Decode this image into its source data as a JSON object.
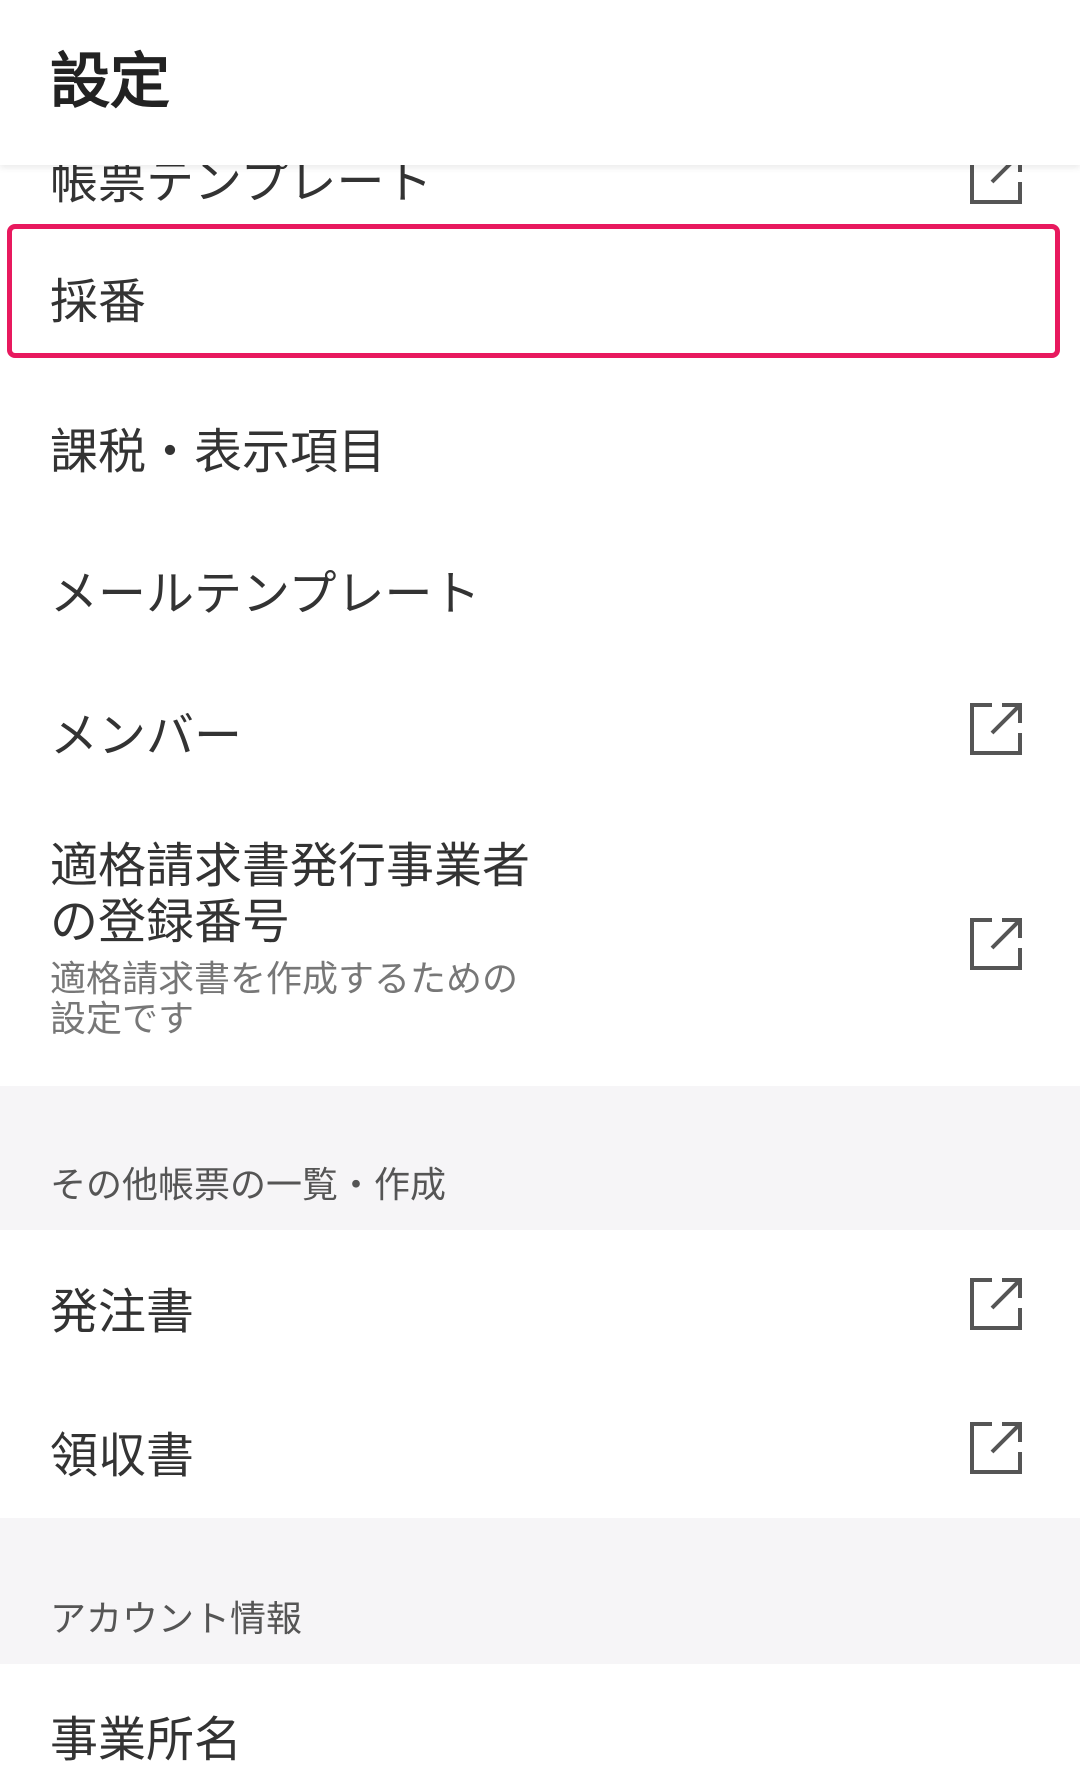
{
  "header": {
    "title": "設定"
  },
  "items": {
    "partial_top": {
      "label": "帳票テンプレート"
    },
    "numbering": {
      "label": "採番"
    },
    "tax_display": {
      "label": "課税・表示項目"
    },
    "mail_template": {
      "label": "メールテンプレート"
    },
    "members": {
      "label": "メンバー"
    },
    "invoice_registration": {
      "label_line1": "適格請求書発行事業者",
      "label_line2": "の登録番号",
      "sub_line1": "適格請求書を作成するための",
      "sub_line2": "設定です"
    },
    "purchase_order": {
      "label": "発注書"
    },
    "receipt": {
      "label": "領収書"
    },
    "business_name": {
      "label": "事業所名"
    }
  },
  "sections": {
    "other_documents": "その他帳票の一覧・作成",
    "account_info": "アカウント情報"
  },
  "icons": {
    "external": "external-link-icon"
  },
  "colors": {
    "highlight": "#e8195e",
    "section_bg": "#f6f5f7"
  }
}
